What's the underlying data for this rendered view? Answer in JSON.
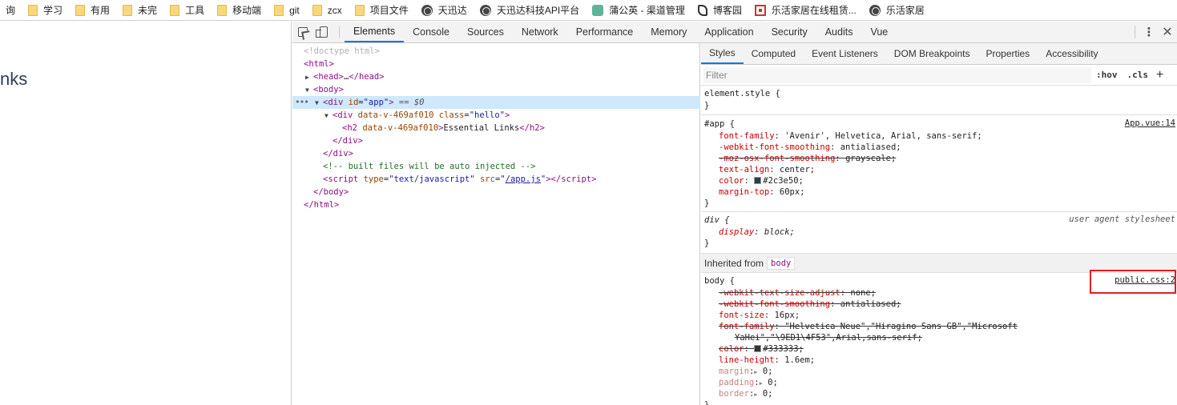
{
  "bookmarks": [
    {
      "label": "询",
      "icon": "folder-icon"
    },
    {
      "label": "学习",
      "icon": "folder-icon"
    },
    {
      "label": "有用",
      "icon": "folder-icon"
    },
    {
      "label": "未完",
      "icon": "folder-icon"
    },
    {
      "label": "工具",
      "icon": "folder-icon"
    },
    {
      "label": "移动端",
      "icon": "folder-icon"
    },
    {
      "label": "git",
      "icon": "folder-icon"
    },
    {
      "label": "zcx",
      "icon": "folder-icon"
    },
    {
      "label": "项目文件",
      "icon": "folder-icon"
    },
    {
      "label": "天迅达",
      "icon": "globe-icon"
    },
    {
      "label": "天迅达科技API平台",
      "icon": "globe-icon"
    },
    {
      "label": "蒲公英 - 渠道管理",
      "icon": "leaf-icon"
    },
    {
      "label": "博客园",
      "icon": "blog-icon"
    },
    {
      "label": "乐活家居在线租赁...",
      "icon": "le-icon"
    },
    {
      "label": "乐活家居",
      "icon": "globe-icon"
    }
  ],
  "page": {
    "visible_text": "nks"
  },
  "devtools": {
    "tabs": [
      "Elements",
      "Console",
      "Sources",
      "Network",
      "Performance",
      "Memory",
      "Application",
      "Security",
      "Audits",
      "Vue"
    ],
    "active_tab": "Elements",
    "icons": [
      "inspect-icon",
      "device-toggle-icon",
      "more-icon",
      "close-icon"
    ]
  },
  "elements": {
    "doctype": "<!doctype html>",
    "html_open": "html",
    "head": "head",
    "head_ellipsis": "…",
    "body": "body",
    "div_app": {
      "tag": "div",
      "attr": "id",
      "value": "\"app\"",
      "suffix": " == $0"
    },
    "div_hello": {
      "tag": "div",
      "attr1": "data-v-469af010",
      "attr2": "class",
      "value2": "\"hello\""
    },
    "h2": {
      "tag": "h2",
      "attr": "data-v-469af010",
      "text": "Essential Links"
    },
    "div_close": "/div",
    "comment": "<!-- built files will be auto injected -->",
    "script": {
      "tag": "script",
      "attr1": "type",
      "value1": "\"text/javascript\"",
      "attr2": "src",
      "value2": "/app.js"
    },
    "body_close": "/body",
    "html_close": "/html"
  },
  "styles": {
    "tabs": [
      "Styles",
      "Computed",
      "Event Listeners",
      "DOM Breakpoints",
      "Properties",
      "Accessibility"
    ],
    "active_tab": "Styles",
    "filter_placeholder": "Filter",
    "hov": ":hov",
    "cls": ".cls",
    "element_style": "element.style {",
    "close_brace": "}",
    "app_rule": {
      "selector": "#app {",
      "source": "App.vue:14",
      "props": [
        {
          "name": "font-family",
          "value": "'Avenir', Helvetica, Arial, sans-serif;"
        },
        {
          "name": "-webkit-font-smoothing",
          "value": "antialiased;"
        },
        {
          "name": "-moz-osx-font-smoothing",
          "value": "grayscale;"
        },
        {
          "name": "text-align",
          "value": "center;"
        },
        {
          "name": "color",
          "value": "#2c3e50;"
        },
        {
          "name": "margin-top",
          "value": "60px;"
        }
      ]
    },
    "div_rule": {
      "selector": "div {",
      "source": "user agent stylesheet",
      "prop": "display",
      "value": "block;"
    },
    "inherited_label": "Inherited from",
    "inherited_tag": "body",
    "body_rule": {
      "selector": "body {",
      "source": "public.css:2",
      "props": [
        {
          "name": "-webkit-text-size-adjust",
          "value": "none;"
        },
        {
          "name": "-webkit-font-smoothing",
          "value": "antialiased;"
        },
        {
          "name": "font-size",
          "value": "16px;"
        },
        {
          "name": "font-family",
          "value": "\"Helvetica Neue\",\"Hiragino Sans GB\",\"Microsoft"
        },
        {
          "name": "",
          "value": "YaHei\",\"\\9ED1\\4F53\",Arial,sans-serif;"
        },
        {
          "name": "color",
          "value": "#333333;"
        },
        {
          "name": "line-height",
          "value": "1.6em;"
        },
        {
          "name": "margin",
          "value": "0;"
        },
        {
          "name": "padding",
          "value": "0;"
        },
        {
          "name": "border",
          "value": "0;"
        }
      ]
    },
    "colors": {
      "app_color": "#2c3e50",
      "body_color": "#333333",
      "highlight": "#e02020",
      "accent": "#1a73e8"
    }
  }
}
